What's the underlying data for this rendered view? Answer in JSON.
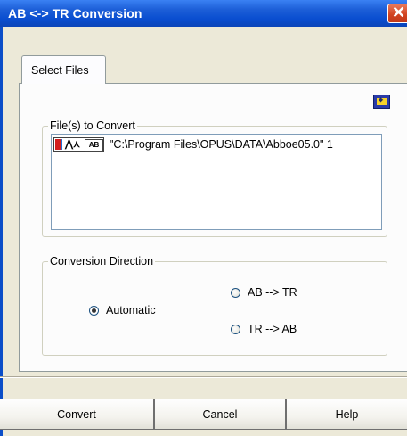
{
  "window": {
    "title": "AB <-> TR Conversion",
    "close_icon": "close-icon"
  },
  "tabs": [
    {
      "label": "Select Files",
      "selected": true
    }
  ],
  "files_group": {
    "legend": "File(s) to Convert",
    "items": [
      {
        "text": "\"C:\\Program Files\\OPUS\\DATA\\Abboe05.0\" 1",
        "icon_badge": "AB"
      }
    ]
  },
  "direction_group": {
    "legend": "Conversion Direction",
    "options": [
      {
        "label": "Automatic",
        "checked": true
      },
      {
        "label": "AB --> TR",
        "checked": false
      },
      {
        "label": "TR --> AB",
        "checked": false
      }
    ]
  },
  "buttons": {
    "convert": "Convert",
    "cancel": "Cancel",
    "help": "Help"
  },
  "colors": {
    "titlebar": "#0a4ed0",
    "close": "#d0421f",
    "face": "#ece9d8"
  }
}
